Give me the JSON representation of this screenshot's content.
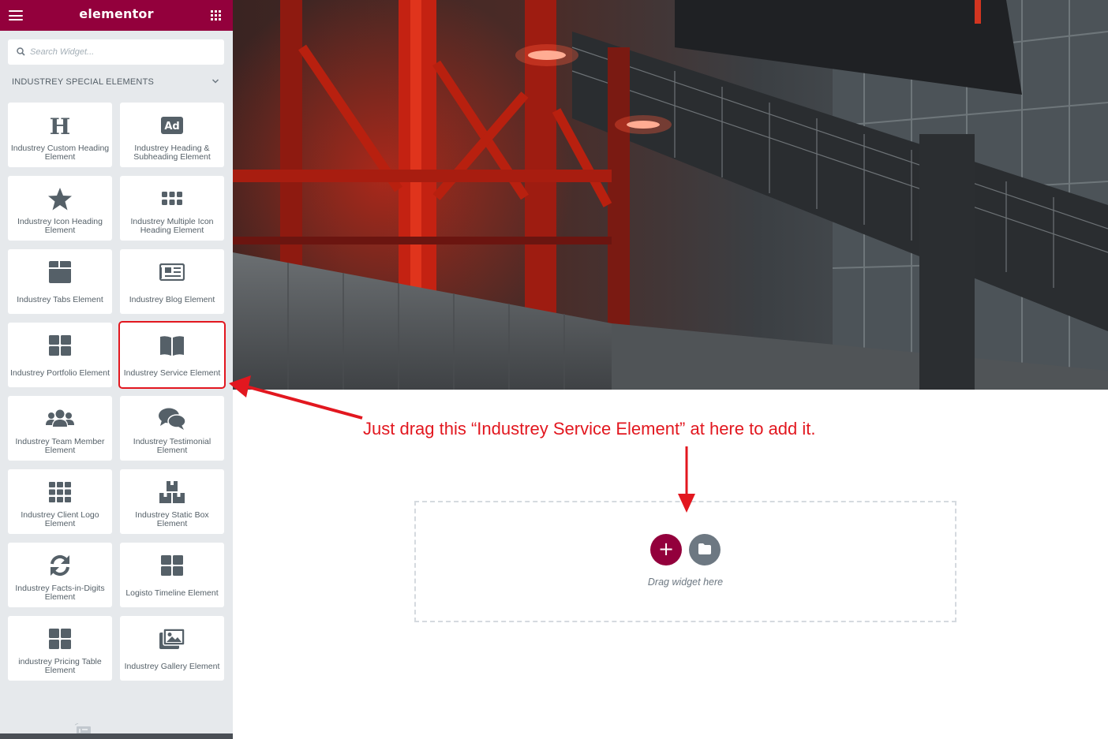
{
  "header": {
    "logo": "elementor"
  },
  "search": {
    "placeholder": "Search Widget..."
  },
  "category": {
    "title": "INDUSTREY SPECIAL ELEMENTS"
  },
  "widgets": [
    {
      "label": "Industrey Custom Heading Element",
      "icon": "heading-icon"
    },
    {
      "label": "Industrey Heading & Subheading Element",
      "icon": "ad-icon"
    },
    {
      "label": "Industrey Icon Heading Element",
      "icon": "star-icon"
    },
    {
      "label": "Industrey Multiple Icon Heading Element",
      "icon": "grid-dots-icon"
    },
    {
      "label": "Industrey Tabs Element",
      "icon": "folder-tabs-icon"
    },
    {
      "label": "Industrey Blog Element",
      "icon": "newspaper-icon"
    },
    {
      "label": "Industrey Portfolio Element",
      "icon": "grid-icon"
    },
    {
      "label": "Industrey Service Element",
      "icon": "book-icon"
    },
    {
      "label": "Industrey Team Member Element",
      "icon": "users-icon"
    },
    {
      "label": "Industrey Testimonial Element",
      "icon": "comments-icon"
    },
    {
      "label": "Industrey Client Logo Element",
      "icon": "grid-nine-icon"
    },
    {
      "label": "Industrey Static Box Element",
      "icon": "boxes-icon"
    },
    {
      "label": "Industrey Facts-in-Digits Element",
      "icon": "sync-icon"
    },
    {
      "label": "Logisto Timeline Element",
      "icon": "grid-icon"
    },
    {
      "label": "industrey Pricing Table Element",
      "icon": "grid-icon"
    },
    {
      "label": "Industrey Gallery Element",
      "icon": "images-icon"
    }
  ],
  "canvas": {
    "annotation": "Just drag this “Industrey Service Element” at here to add it.",
    "drop_text": "Drag widget here"
  },
  "colors": {
    "brand": "#93003c",
    "annotation": "#e2171f",
    "panel": "#e6e9ec"
  }
}
